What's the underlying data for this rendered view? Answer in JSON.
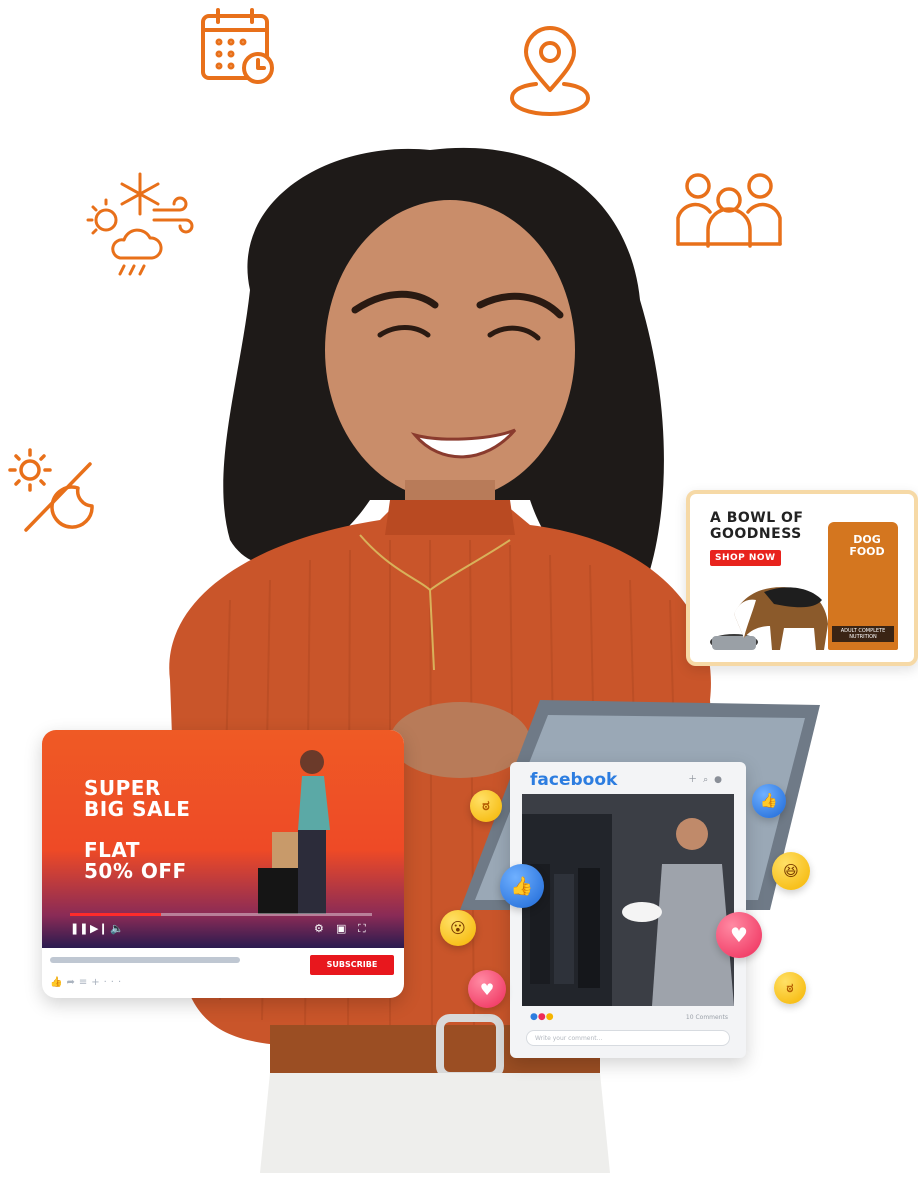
{
  "icons": [
    "calendar-clock-icon",
    "location-pin-icon",
    "weather-icon",
    "people-group-icon",
    "day-night-icon"
  ],
  "brand_color": "#e8701a",
  "dog_ad": {
    "headline": "A BOWL OF GOODNESS",
    "cta": "SHOP NOW",
    "bag_label": "DOG FOOD",
    "bag_footer": "ADULT COMPLETE NUTRITION"
  },
  "youtube_card": {
    "promo_line1": "SUPER",
    "promo_line2": "BIG SALE",
    "promo_line3": "FLAT",
    "promo_line4": "50% OFF",
    "progress": 0.3,
    "subscribe_label": "SUBSCRIBE"
  },
  "facebook_card": {
    "logo": "facebook",
    "comment_count": "10 Comments",
    "comment_placeholder": "Write your comment..."
  }
}
